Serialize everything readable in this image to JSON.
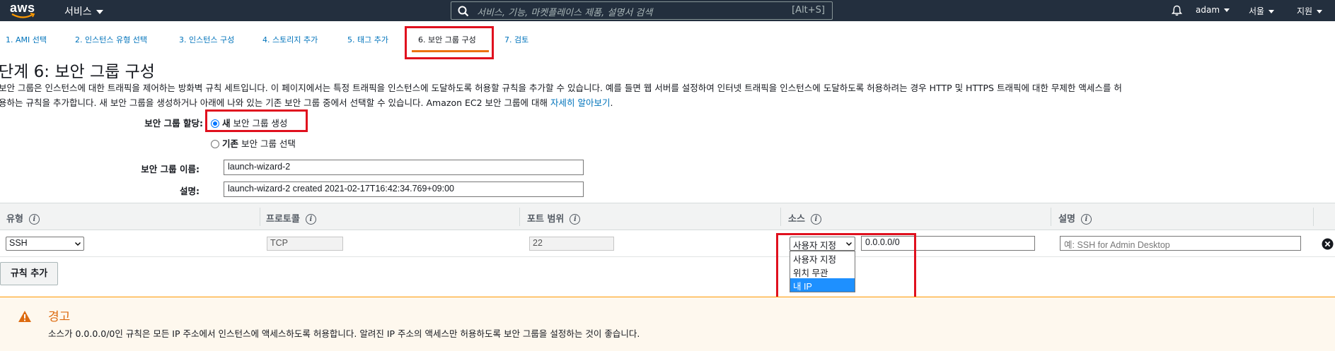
{
  "topnav": {
    "logo": "aws",
    "services_label": "서비스",
    "search_placeholder": "서비스, 기능, 마켓플레이스 제품, 설명서 검색",
    "search_shortcut": "[Alt+S]",
    "user": "adam",
    "region": "서울",
    "support": "지원",
    "bg_color": "#232f3e"
  },
  "steps": [
    {
      "label": "1. AMI 선택"
    },
    {
      "label": "2. 인스턴스 유형 선택"
    },
    {
      "label": "3. 인스턴스 구성"
    },
    {
      "label": "4. 스토리지 추가"
    },
    {
      "label": "5. 태그 추가"
    },
    {
      "label": "6. 보안 그룹 구성",
      "active": true
    },
    {
      "label": "7. 검토"
    }
  ],
  "page": {
    "title": "단계 6: 보안 그룹 구성",
    "desc_line1": "보안 그룹은 인스턴스에 대한 트래픽을 제어하는 방화벽 규칙 세트입니다. 이 페이지에서는 특정 트래픽을 인스턴스에 도달하도록 허용할 규칙을 추가할 수 있습니다. 예를 들면 웹 서버를 설정하여 인터넷 트래픽을 인스턴스에 도달하도록 허용하려는 경우 HTTP 및 HTTPS 트래픽에 대한 무제한 액세스를 허",
    "desc_line2": "용하는 규칙을 추가합니다. 새 보안 그룹을 생성하거나 아래에 나와 있는 기존 보안 그룹 중에서 선택할 수 있습니다. Amazon EC2 보안 그룹에 대해 ",
    "desc_link": "자세히 알아보기",
    "desc_end": "."
  },
  "form": {
    "assign_label": "보안 그룹 할당:",
    "option_new_bold": "새",
    "option_new_rest": " 보안 그룹 생성",
    "option_existing_bold": "기존",
    "option_existing_rest": " 보안 그룹 선택",
    "name_label": "보안 그룹 이름:",
    "name_value": "launch-wizard-2",
    "desc_label": "설명:",
    "desc_value": "launch-wizard-2 created 2021-02-17T16:42:34.769+09:00"
  },
  "table": {
    "headers": [
      "유형",
      "프로토콜",
      "포트 범위",
      "소스",
      "설명"
    ],
    "info_glyph": "i",
    "row": {
      "type": "SSH",
      "protocol": "TCP",
      "port": "22",
      "source_mode": "사용자 지정",
      "source_cidr": "0.0.0.0/0",
      "description_placeholder": "예: SSH for Admin Desktop"
    },
    "source_options": [
      {
        "label": "사용자 지정"
      },
      {
        "label": "위치 무관"
      },
      {
        "label": "내 IP",
        "highlighted": true
      }
    ]
  },
  "add_rule_label": "규칙 추가",
  "warning": {
    "title": "경고",
    "text": "소스가 0.0.0.0/0인 규칙은 모든 IP 주소에서 인스턴스에 액세스하도록 허용합니다. 알려진 IP 주소의 액세스만 허용하도록 보안 그룹을 설정하는 것이 좋습니다.",
    "accent_color": "#dd6b10"
  },
  "highlight_color": "#e0101e"
}
